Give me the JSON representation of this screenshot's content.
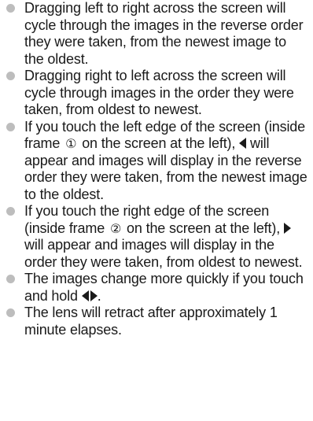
{
  "bullets": [
    {
      "text": "Dragging left to right across the screen will cycle through the images in the reverse order they were taken, from the newest image to the oldest."
    },
    {
      "text": "Dragging right to left across the screen will cycle through images in the order they were taken, from oldest to newest."
    },
    {
      "part1": "If you touch the left edge of the screen (inside frame",
      "marker": "①",
      "part2": "on the screen at the left),",
      "icon": "left-triangle-icon",
      "part3": "will appear and images will display in the reverse order they were taken, from the newest image to the oldest."
    },
    {
      "part1": "If you touch the right edge of the screen (inside frame",
      "marker": "②",
      "part2": "on the screen at the left),",
      "icon": "right-triangle-icon",
      "part3": "will appear and images will display in the order they were taken, from oldest to newest."
    },
    {
      "part1": "The images change more quickly if you touch and hold",
      "icon": "left-right-triangles-icon",
      "part2": "."
    },
    {
      "text": "The lens will retract after approximately 1 minute elapses."
    }
  ]
}
